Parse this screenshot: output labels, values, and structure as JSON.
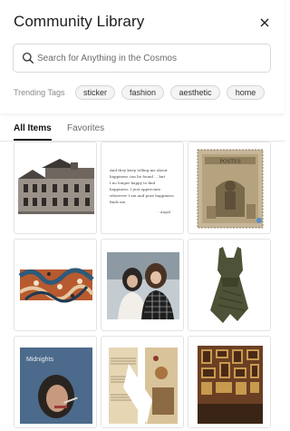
{
  "header": {
    "title": "Community Library",
    "close_icon": "close-icon"
  },
  "search": {
    "placeholder": "Search for Anything in the Cosmos",
    "value": "",
    "icon": "search-icon"
  },
  "trending": {
    "label": "Trending Tags",
    "tags": [
      "sticker",
      "fashion",
      "aesthetic",
      "home"
    ]
  },
  "tabs": [
    {
      "label": "All Items",
      "active": true
    },
    {
      "label": "Favorites",
      "active": false
    }
  ],
  "items": [
    {
      "name": "building-sticker"
    },
    {
      "name": "handwritten-note",
      "text_lines": [
        "And they keep telling me about",
        "happiness can be found ... but",
        "I no longer happy to find",
        "happiness. I just appreciate",
        "wherever I am and pure happiness",
        "finds me."
      ],
      "signature": "- Angel"
    },
    {
      "name": "vintage-postage-stamp",
      "stamp_text": "POSTES"
    },
    {
      "name": "patterned-fabric-sticker"
    },
    {
      "name": "friends-photo"
    },
    {
      "name": "green-dress"
    },
    {
      "name": "midnights-album-cover",
      "album_title": "Midnights"
    },
    {
      "name": "sheet-music-collage"
    },
    {
      "name": "art-gallery-room"
    }
  ],
  "colors": {
    "accent": "#111111",
    "tag_bg": "#f4f4f4",
    "border": "#e3e3e3"
  }
}
